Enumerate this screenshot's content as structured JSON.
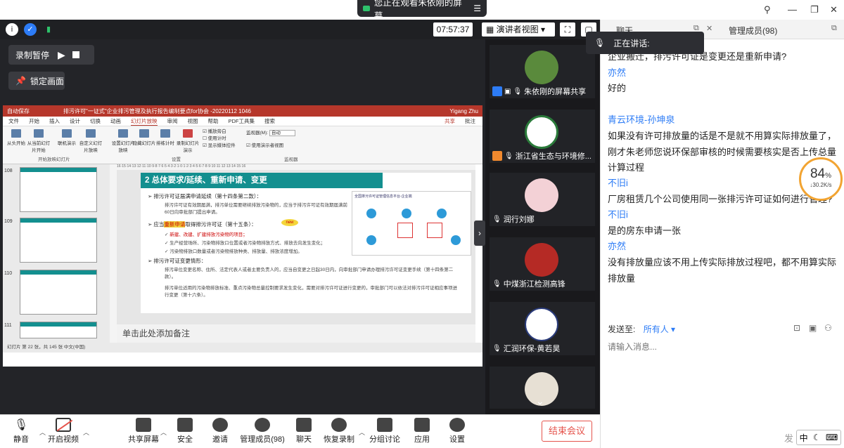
{
  "topbar": {
    "watching_text": "您正在观看朱依刚的屏幕"
  },
  "toolbar2": {
    "timer": "07:57:37",
    "presenter_view": "演讲者视图"
  },
  "recording": {
    "pause_label": "录制暂停",
    "lock_label": "锁定画面"
  },
  "ppt": {
    "title_left": "自动保存",
    "doc_title": "排污许可\"一证式\"企业排污管理及执行报告编制要点for协会 -20220112 1046",
    "user": "Yigang Zhu",
    "tabs": [
      "文件",
      "开始",
      "插入",
      "设计",
      "切换",
      "动画",
      "幻灯片放映",
      "审阅",
      "视图",
      "帮助",
      "PDF工具集",
      "搜索"
    ],
    "active_tab": "幻灯片放映",
    "share": "共享",
    "comment": "批注",
    "ribbon": {
      "items": [
        "从头开始",
        "从当前幻灯片开始",
        "联机演示",
        "自定义幻灯片放映",
        "设置幻灯片放映",
        "隐藏幻灯片",
        "排练计时",
        "录制幻灯片演示"
      ],
      "checkboxes": [
        "播放旁白",
        "使用计时",
        "显示媒体控件"
      ],
      "monitor_label": "监视器(M):",
      "monitor_value": "自动",
      "presenter_checkbox": "使用演示者视图",
      "groups": [
        "开始放映幻灯片",
        "设置",
        "监视器"
      ]
    },
    "thumbs": [
      {
        "num": "108"
      },
      {
        "num": "109"
      },
      {
        "num": "110"
      },
      {
        "num": "111"
      }
    ],
    "ruler": "16·15·14·13·12·11·10·9·8·7·6·5·4·3·2·1·0·1·2·3·4·5·6·7·8·9·10·11·12·13·14·15·16",
    "slide": {
      "heading": "2 总体要求/延续、重新申请、变更",
      "b1": "排污许可证届满申请延续（第十四条第二款）：",
      "b1s": "排污许可证有效期届满，排污单位需要继续排放污染物的，应当于排污许可证有效期届满前60日向审批部门提出申请。",
      "b2_pre": "应当",
      "b2_hl": "重新申请",
      "b2_post": "取得排污许可证（第十五条）：",
      "new_badge": "new",
      "b2s1": "新建、改建、扩建排放污染物的项目；",
      "b2s2": "生产经营场所、污染物排放口位置或者污染物排放方式、排放去向发生变化；",
      "b2s3": "污染物排放口数量或者污染物排放种类、排放量、排放浓度增加。",
      "b3": "排污许可证变更情形：",
      "b3s1": "排污单位变更名称、住所、法定代表人或者主要负责人的，应当自变更之日起30日内，向审批部门申请办理排污许可证变更手续（第十四条第二款）。",
      "b3s2": "排污单位适用的污染物排放标准、重点污染物总量控制要求发生变化，需要对排污许可证进行变更的，审批部门可以依法对排污许可证相应事项进行变更（第十六条）。",
      "inset_title": "全国排污许可证管理信息平台-企业端"
    },
    "notes": "单击此处添加备注",
    "status": "幻灯片 第 22 张，共 145 张    中文(中国)"
  },
  "tiles": [
    {
      "name": "朱依刚的屏幕共享"
    },
    {
      "name": "浙江省生态与环境修..."
    },
    {
      "name": "润行刘娜"
    },
    {
      "name": "中煤浙江检测高锋"
    },
    {
      "name": "汇润环保-黄若昊"
    },
    {
      "name": ""
    }
  ],
  "speaking": "正在讲话:",
  "chat": {
    "tab_chat": "聊天",
    "tab_members": "管理成员(98)",
    "messages": [
      {
        "type": "text",
        "text": "企业搬迁，排污许可证是变更还是重新申请?"
      },
      {
        "type": "name",
        "text": "亦然"
      },
      {
        "type": "text",
        "text": "好的"
      },
      {
        "type": "name",
        "text": "青云环境-孙坤泉"
      },
      {
        "type": "text",
        "text": "如果没有许可排放量的话是不是就不用算实际排放量了，刚才朱老师您说环保部审核的时候需要核实是否上传总量计算过程"
      },
      {
        "type": "name",
        "text": "不旧i"
      },
      {
        "type": "text",
        "text": "厂房租赁几个公司使用同一张排污许可证如何进行管理?"
      },
      {
        "type": "name",
        "text": "不旧i"
      },
      {
        "type": "text",
        "text": "是的房东申请一张"
      },
      {
        "type": "name",
        "text": "亦然"
      },
      {
        "type": "text",
        "text": "没有排放量应该不用上传实际排放过程吧，都不用算实际排放量"
      }
    ],
    "send_to_label": "发送至:",
    "send_to_value": "所有人",
    "input_placeholder": "请输入消息...",
    "send_label": "发",
    "ime_label": "中"
  },
  "progress": {
    "percent": "84",
    "percent_sign": "%",
    "rate": "30.2K/s",
    "value": 0.84
  },
  "bottombar": {
    "items": [
      "静音",
      "开启视频",
      "共享屏幕",
      "安全",
      "邀请",
      "管理成员(98)",
      "聊天",
      "恢复录制",
      "分组讨论",
      "应用",
      "设置"
    ],
    "end": "结束会议"
  }
}
